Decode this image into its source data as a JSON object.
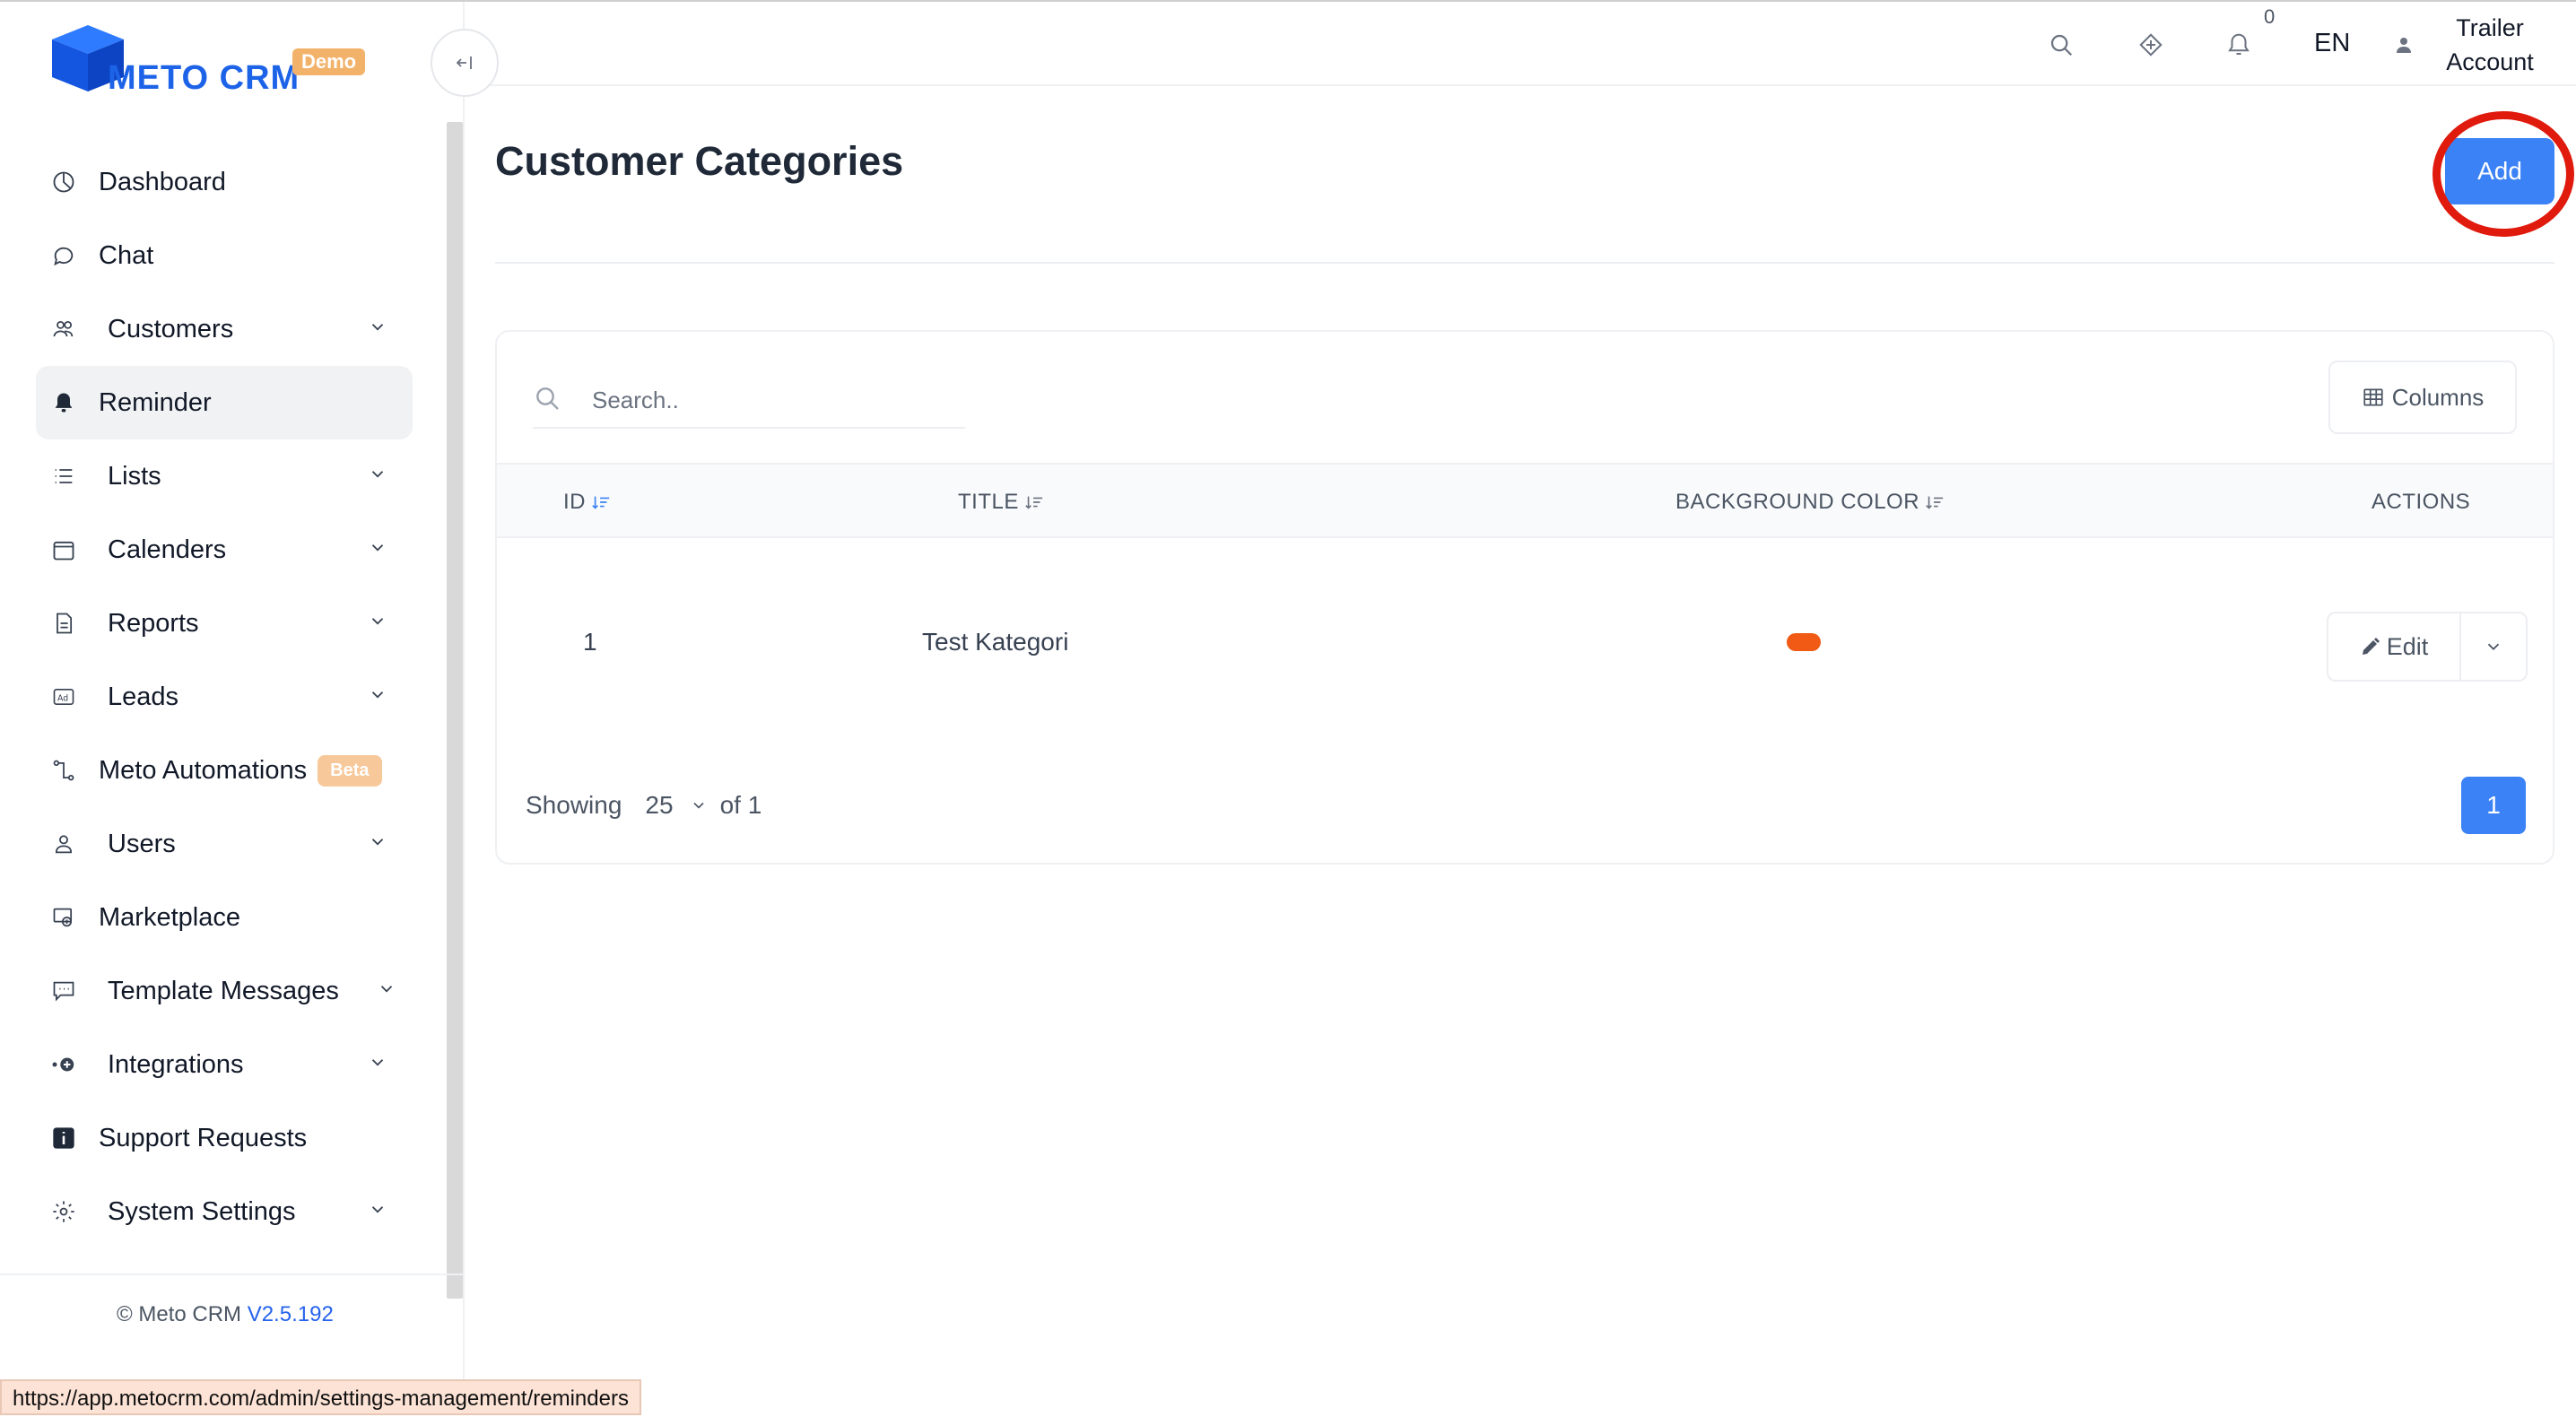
{
  "brand": {
    "name": "METO CRM",
    "badge": "Demo"
  },
  "sidebar": {
    "items": [
      {
        "label": "Dashboard",
        "icon": "pie-chart-icon"
      },
      {
        "label": "Chat",
        "icon": "chat-bubble-icon"
      },
      {
        "label": "Customers",
        "icon": "users-icon",
        "expandable": true
      },
      {
        "label": "Reminder",
        "icon": "bell-icon",
        "active": true
      },
      {
        "label": "Lists",
        "icon": "list-icon",
        "expandable": true
      },
      {
        "label": "Calenders",
        "icon": "calendar-icon",
        "expandable": true
      },
      {
        "label": "Reports",
        "icon": "document-icon",
        "expandable": true
      },
      {
        "label": "Leads",
        "icon": "ad-icon",
        "expandable": true
      },
      {
        "label": "Meto Automations",
        "icon": "flow-icon",
        "badge": "Beta"
      },
      {
        "label": "Users",
        "icon": "user-icon",
        "expandable": true
      },
      {
        "label": "Marketplace",
        "icon": "store-icon"
      },
      {
        "label": "Template Messages",
        "icon": "message-template-icon",
        "expandable": true
      },
      {
        "label": "Integrations",
        "icon": "plug-icon",
        "expandable": true
      },
      {
        "label": "Support Requests",
        "icon": "info-icon"
      },
      {
        "label": "System Settings",
        "icon": "gear-icon",
        "expandable": true
      }
    ],
    "footer": {
      "copyright": "© Meto CRM",
      "version": "V2.5.192"
    }
  },
  "header": {
    "notification_count": "0",
    "language": "EN",
    "user_line1": "Trailer",
    "user_line2": "Account"
  },
  "page": {
    "title": "Customer Categories",
    "add_label": "Add"
  },
  "table": {
    "search_placeholder": "Search..",
    "columns_label": "Columns",
    "headers": {
      "id": "ID",
      "title": "TITLE",
      "bg_color": "BACKGROUND COLOR",
      "actions": "ACTIONS"
    },
    "rows": [
      {
        "id": "1",
        "title": "Test Kategori",
        "bg_color": "#f05a14",
        "edit_label": "Edit"
      }
    ]
  },
  "pagination": {
    "showing_label": "Showing",
    "page_size": "25",
    "of_label": "of 1",
    "current_page": "1"
  },
  "status_bar_url": "https://app.metocrm.com/admin/settings-management/reminders",
  "colors": {
    "accent": "#3b82f6",
    "highlight_ring": "#e01a0d",
    "badge_orange": "#f3b26a"
  }
}
